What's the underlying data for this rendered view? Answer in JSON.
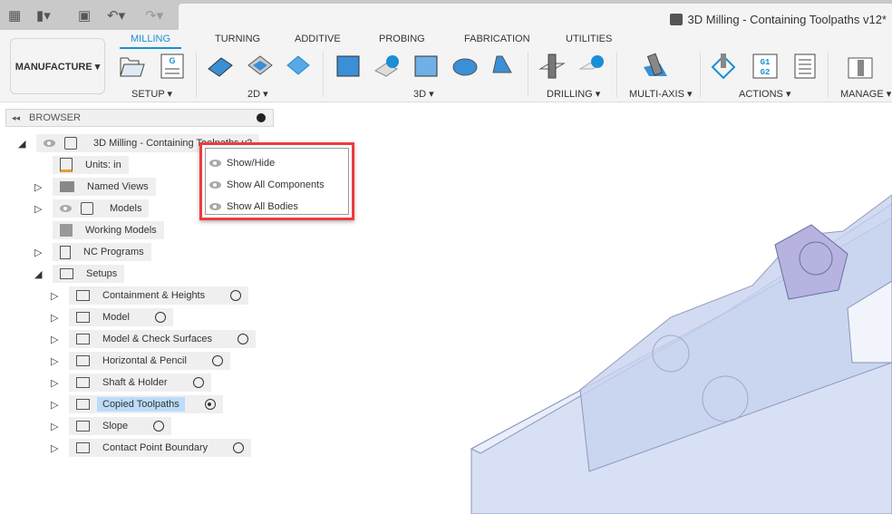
{
  "quick_access": {
    "grid_icon": "app-grid-icon",
    "file_icon": "file-icon",
    "save_icon": "save-icon",
    "undo_icon": "undo-icon",
    "redo_icon": "redo-icon"
  },
  "document": {
    "title": "3D Milling - Containing  Toolpaths v12*"
  },
  "workspace": {
    "label": "MANUFACTURE ▾"
  },
  "tabs": [
    "MILLING",
    "TURNING",
    "ADDITIVE",
    "PROBING",
    "FABRICATION",
    "UTILITIES"
  ],
  "groups": {
    "setup": "SETUP ▾",
    "d2": "2D ▾",
    "d3": "3D ▾",
    "drilling": "DRILLING ▾",
    "multiaxis": "MULTI-AXIS ▾",
    "actions": "ACTIONS ▾",
    "manage": "MANAGE ▾"
  },
  "actions_g1g2": "G1\nG2",
  "browser": {
    "title": "BROWSER",
    "collapse": "◂◂"
  },
  "tree": {
    "root": "3D Milling - Containing  Toolpaths v2",
    "units": "Units: in",
    "named_views": "Named Views",
    "models": "Models",
    "working_models": "Working Models",
    "nc_programs": "NC Programs",
    "setups": "Setups",
    "setup_items": [
      {
        "label": "Containment & Heights",
        "selected": false,
        "active": false
      },
      {
        "label": "Model",
        "selected": false,
        "active": false
      },
      {
        "label": "Model & Check Surfaces",
        "selected": false,
        "active": false
      },
      {
        "label": "Horizontal & Pencil",
        "selected": false,
        "active": false
      },
      {
        "label": "Shaft & Holder",
        "selected": false,
        "active": false
      },
      {
        "label": "Copied Toolpaths",
        "selected": true,
        "active": true
      },
      {
        "label": "Slope",
        "selected": false,
        "active": false
      },
      {
        "label": "Contact Point Boundary",
        "selected": false,
        "active": false
      }
    ]
  },
  "context_menu": [
    "Show/Hide",
    "Show All Components",
    "Show All Bodies"
  ],
  "colors": {
    "accent": "#1a8fd6",
    "highlight": "#ef3b3e",
    "selection": "#bcdcfb"
  }
}
